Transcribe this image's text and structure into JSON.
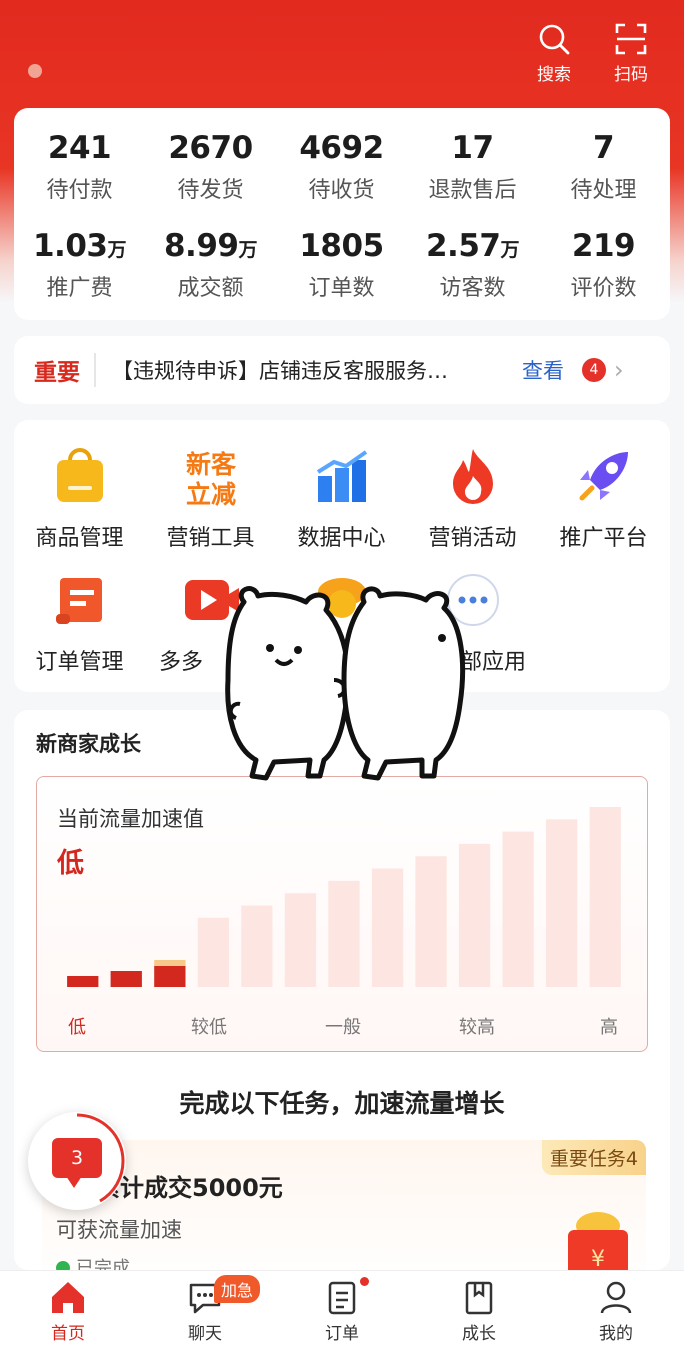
{
  "header": {
    "search_label": "搜索",
    "scan_label": "扫码"
  },
  "stats": [
    {
      "value": "241",
      "unit": "",
      "label": "待付款"
    },
    {
      "value": "2670",
      "unit": "",
      "label": "待发货"
    },
    {
      "value": "4692",
      "unit": "",
      "label": "待收货"
    },
    {
      "value": "17",
      "unit": "",
      "label": "退款售后"
    },
    {
      "value": "7",
      "unit": "",
      "label": "待处理"
    },
    {
      "value": "1.03",
      "unit": "万",
      "label": "推广费"
    },
    {
      "value": "8.99",
      "unit": "万",
      "label": "成交额"
    },
    {
      "value": "1805",
      "unit": "",
      "label": "订单数"
    },
    {
      "value": "2.57",
      "unit": "万",
      "label": "访客数"
    },
    {
      "value": "219",
      "unit": "",
      "label": "评价数"
    }
  ],
  "notice": {
    "tag": "重要",
    "text": "【违规待申诉】店铺违反客服服务…",
    "view_label": "查看",
    "badge": "4"
  },
  "apps": [
    {
      "label": "商品管理",
      "icon": "shopping-bag-icon"
    },
    {
      "label": "营销工具",
      "icon": "new-customer-discount-icon",
      "icon_text": [
        "新客",
        "立减"
      ]
    },
    {
      "label": "数据中心",
      "icon": "bar-chart-icon"
    },
    {
      "label": "营销活动",
      "icon": "fire-icon"
    },
    {
      "label": "推广平台",
      "icon": "rocket-icon"
    },
    {
      "label": "订单管理",
      "icon": "order-scroll-icon"
    },
    {
      "label": "多多",
      "icon": "video-play-icon"
    },
    {
      "label": "",
      "icon": "mascot-icon"
    },
    {
      "label": "部应用",
      "icon": "more-dots-icon"
    }
  ],
  "growth": {
    "title": "新商家成长",
    "chart_label": "当前流量加速值",
    "current_level": "低",
    "axis_labels": [
      "低",
      "较低",
      "一般",
      "较高",
      "高"
    ],
    "task_heading": "完成以下任务，加速流量增长",
    "task": {
      "tag": "重要任务4",
      "title": "累计成交5000元",
      "subtitle": "可获流量加速",
      "status": "已完成"
    }
  },
  "chart_data": {
    "type": "bar",
    "categories": [
      "1",
      "2",
      "3",
      "4",
      "5",
      "6",
      "7",
      "8",
      "9",
      "10",
      "11",
      "12",
      "13"
    ],
    "values": [
      1,
      2,
      3,
      4,
      5,
      6,
      7,
      8,
      9,
      10,
      11,
      12,
      13
    ],
    "active_count": 3,
    "x_tick_labels": [
      "低",
      "较低",
      "一般",
      "较高",
      "高"
    ],
    "colors": {
      "active": "#d2281e",
      "inactive": "#fde6e1"
    }
  },
  "floating_message": {
    "count": "3"
  },
  "nav": [
    {
      "label": "首页",
      "icon": "home-icon",
      "active": true
    },
    {
      "label": "聊天",
      "icon": "chat-icon",
      "badge": "加急"
    },
    {
      "label": "订单",
      "icon": "order-icon",
      "dot": true
    },
    {
      "label": "成长",
      "icon": "growth-book-icon"
    },
    {
      "label": "我的",
      "icon": "user-icon"
    }
  ],
  "colors": {
    "brand": "#e22a1f",
    "link": "#2a62c9"
  }
}
